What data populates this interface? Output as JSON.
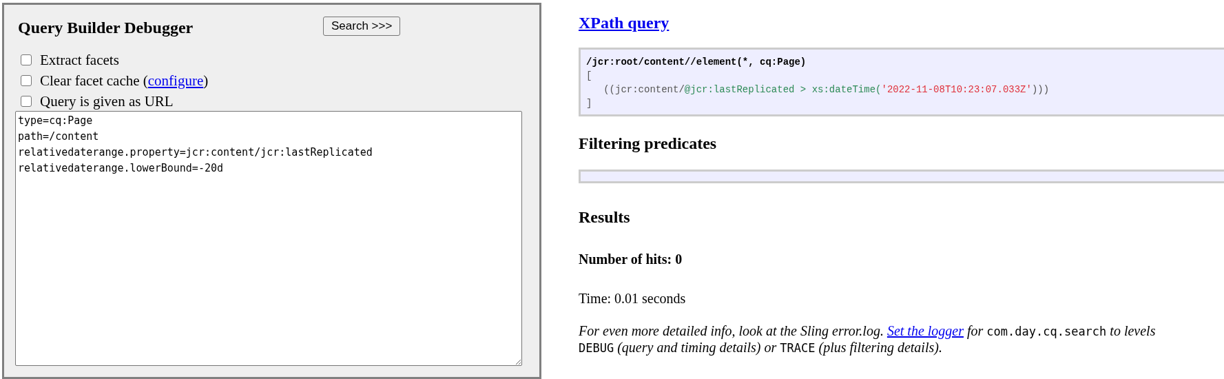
{
  "query_panel": {
    "title": "Query Builder Debugger",
    "search_button": "Search >>>",
    "options": [
      {
        "label": "Extract facets",
        "checked": false
      },
      {
        "label": "Clear facet cache (",
        "link": "configure",
        "after": ")",
        "checked": false
      },
      {
        "label": "Query is given as URL",
        "checked": false
      }
    ],
    "query_text": "type=cq:Page\npath=/content\nrelativedaterange.property=jcr:content/jcr:lastReplicated\nrelativedaterange.lowerBound=-20d"
  },
  "xpath": {
    "heading": "XPath query",
    "lines": [
      [
        {
          "kind": "path",
          "text": "/jcr:root/content//element(*, cq:Page)"
        }
      ],
      [
        {
          "kind": "punct",
          "text": "["
        }
      ],
      [
        {
          "kind": "punct",
          "text": "   ((jcr:content/"
        },
        {
          "kind": "attr",
          "text": "@jcr:lastReplicated > xs:dateTime("
        },
        {
          "kind": "string",
          "text": "'2022-11-08T10:23:07.033Z'"
        },
        {
          "kind": "punct",
          "text": ")))"
        }
      ],
      [
        {
          "kind": "punct",
          "text": "]"
        }
      ]
    ]
  },
  "filtering": {
    "heading": "Filtering predicates"
  },
  "results": {
    "heading": "Results",
    "hits": "Number of hits: 0",
    "time": "Time: 0.01 seconds",
    "info": [
      {
        "kind": "text",
        "text": "For even more detailed info, look at the Sling error.log. "
      },
      {
        "kind": "link",
        "text": "Set the logger"
      },
      {
        "kind": "text",
        "text": " for "
      },
      {
        "kind": "code",
        "text": "com.day.cq.search"
      },
      {
        "kind": "text",
        "text": " to levels "
      },
      {
        "kind": "code",
        "text": "DEBUG"
      },
      {
        "kind": "text",
        "text": " (query and timing details) or "
      },
      {
        "kind": "code",
        "text": "TRACE"
      },
      {
        "kind": "text",
        "text": " (plus filtering details)."
      }
    ]
  }
}
